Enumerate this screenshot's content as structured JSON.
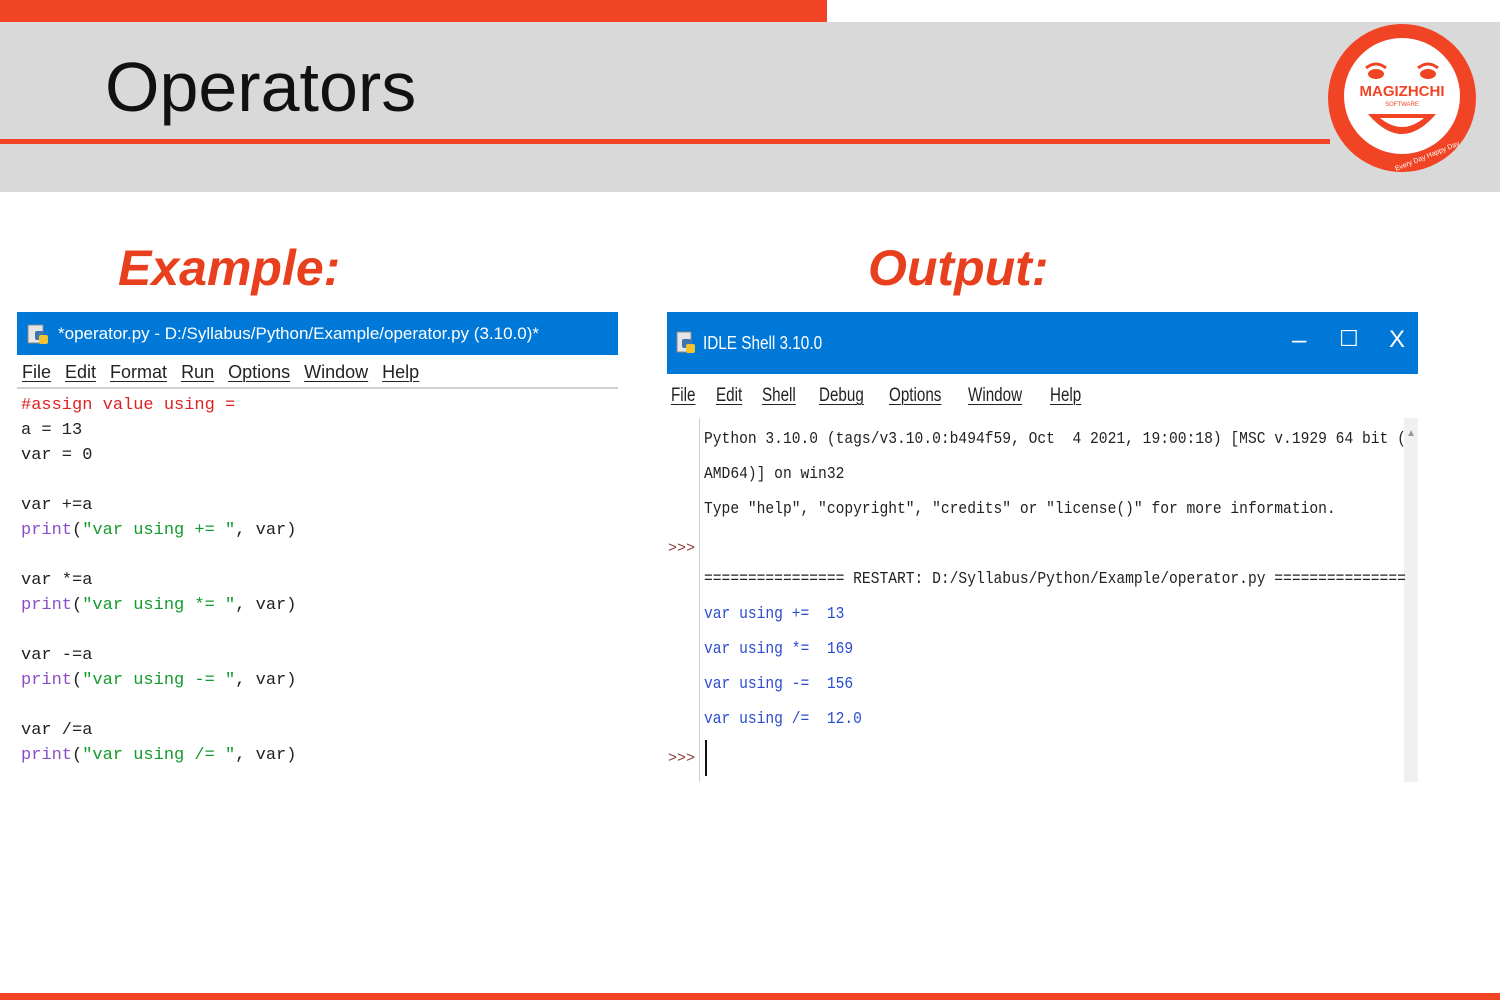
{
  "slide": {
    "title": "Operators",
    "example_heading": "Example:",
    "output_heading": "Output:"
  },
  "logo": {
    "name": "MAGIZHCHI",
    "sub": "SOFTWARE",
    "tagline": "Every Day Happy Day"
  },
  "colors": {
    "accent": "#f04425",
    "header_bg": "#d9d9d9",
    "titlebar_blue": "#0078d7",
    "heading_red": "#e8401f"
  },
  "editor": {
    "title": "*operator.py - D:/Syllabus/Python/Example/operator.py (3.10.0)*",
    "menu": [
      "File",
      "Edit",
      "Format",
      "Run",
      "Options",
      "Window",
      "Help"
    ],
    "code": {
      "l1_comment": "#assign value using =",
      "l2": "a = 13",
      "l3": "var = 0",
      "l5": "var +=a",
      "l6_kw": "print",
      "l6_a": "(",
      "l6_str": "\"var using += \"",
      "l6_b": ", var)",
      "l8": "var *=a",
      "l9_kw": "print",
      "l9_a": "(",
      "l9_str": "\"var using *= \"",
      "l9_b": ", var)",
      "l11": "var -=a",
      "l12_kw": "print",
      "l12_a": "(",
      "l12_str": "\"var using -= \"",
      "l12_b": ", var)",
      "l14": "var /=a",
      "l15_kw": "print",
      "l15_a": "(",
      "l15_str": "\"var using /= \"",
      "l15_b": ", var)"
    }
  },
  "shell": {
    "title": "IDLE Shell 3.10.0",
    "controls": {
      "minimize": "–",
      "maximize": "☐",
      "close": "X"
    },
    "menu": [
      "File",
      "Edit",
      "Shell",
      "Debug",
      "Options",
      "Window",
      "Help"
    ],
    "banner_1": "Python 3.10.0 (tags/v3.10.0:b494f59, Oct  4 2021, 19:00:18) [MSC v.1929 64 bit (",
    "banner_2": "AMD64)] on win32",
    "banner_3": "Type \"help\", \"copyright\", \"credits\" or \"license()\" for more information.",
    "prompt": ">>>",
    "restart": "================ RESTART: D:/Syllabus/Python/Example/operator.py ===============",
    "outputs": [
      "var using +=  13",
      "var using *=  169",
      "var using -=  156",
      "var using /=  12.0"
    ]
  }
}
